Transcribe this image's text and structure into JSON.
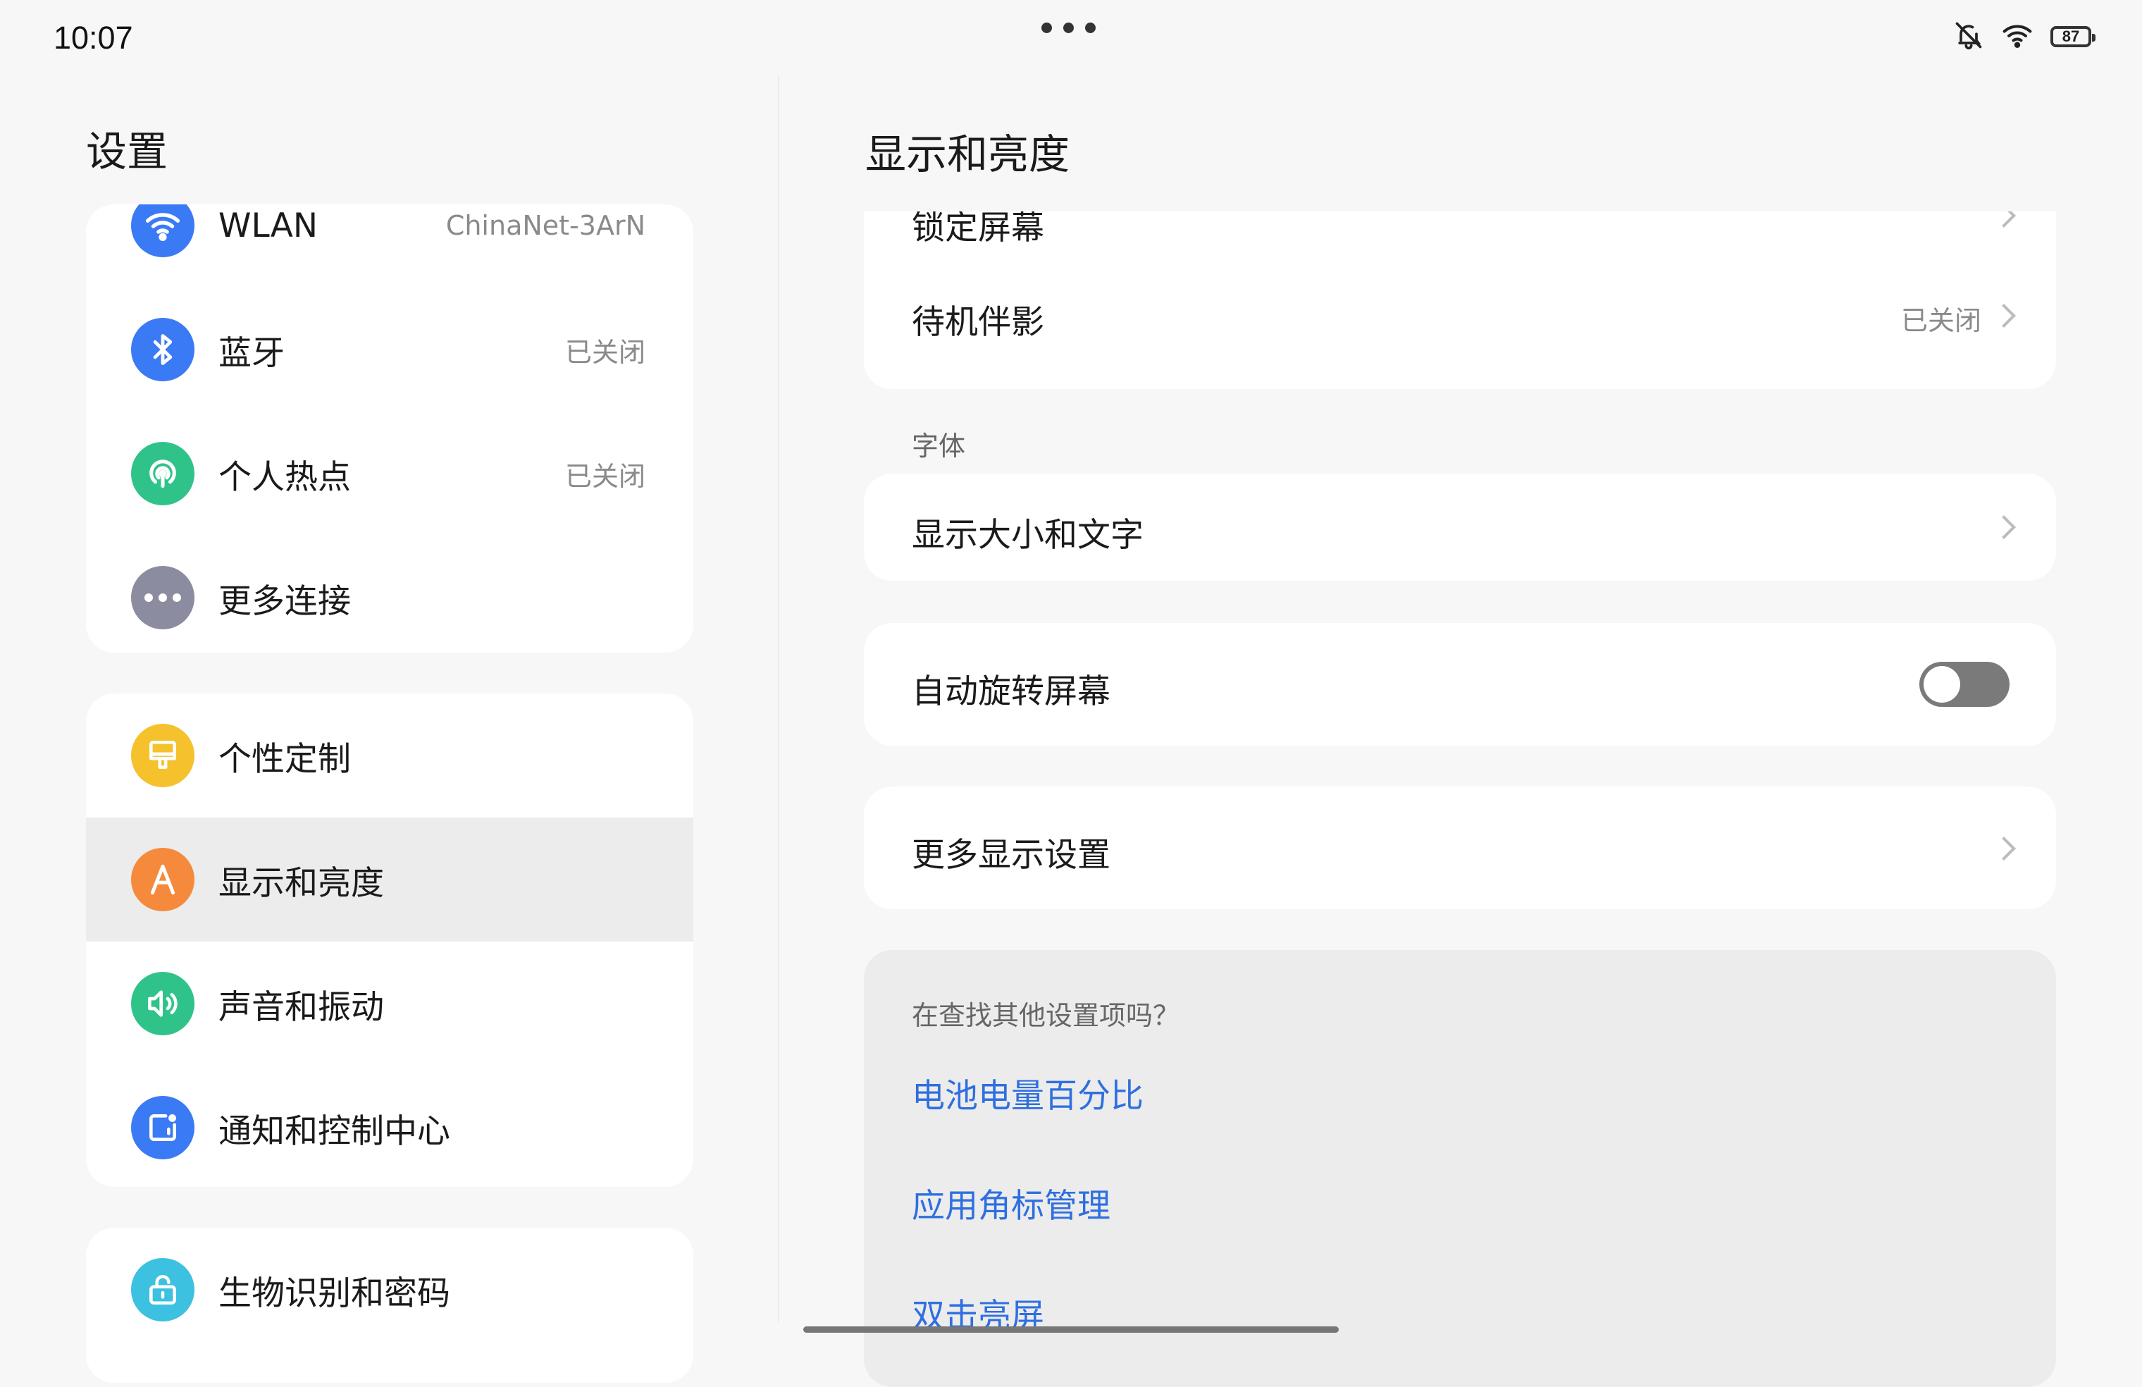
{
  "status_bar": {
    "time": "10:07",
    "battery": "87",
    "icons": [
      "bell-off-icon",
      "wifi-icon",
      "battery-icon"
    ]
  },
  "left": {
    "title": "设置",
    "groups": [
      [
        {
          "label": "WLAN",
          "value": "ChinaNet-3ArN",
          "icon": "wifi-icon",
          "color": "#3b7af5"
        },
        {
          "label": "蓝牙",
          "value": "已关闭",
          "icon": "bluetooth-icon",
          "color": "#3b7af5"
        },
        {
          "label": "个人热点",
          "value": "已关闭",
          "icon": "hotspot-icon",
          "color": "#2fc38a"
        },
        {
          "label": "更多连接",
          "value": "",
          "icon": "more-dots-icon",
          "color": "#8c8ca0"
        }
      ],
      [
        {
          "label": "个性定制",
          "icon": "brush-icon",
          "color": "#f5c12c"
        },
        {
          "label": "显示和亮度",
          "icon": "display-a-icon",
          "color": "#f58a3c",
          "active": true
        },
        {
          "label": "声音和振动",
          "icon": "speaker-icon",
          "color": "#2fc38a"
        },
        {
          "label": "通知和控制中心",
          "icon": "notification-icon",
          "color": "#3b7af5"
        }
      ],
      [
        {
          "label": "生物识别和密码",
          "icon": "lock-icon",
          "color": "#3cc1e0"
        }
      ]
    ]
  },
  "right": {
    "title": "显示和亮度",
    "partial_item": "锁定屏幕",
    "standby": {
      "label": "待机伴影",
      "value": "已关闭"
    },
    "font_section": "字体",
    "display_size": "显示大小和文字",
    "auto_rotate": {
      "label": "自动旋转屏幕",
      "on": false
    },
    "more_display": "更多显示设置",
    "suggestions": {
      "question": "在查找其他设置项吗？",
      "links": [
        "电池电量百分比",
        "应用角标管理",
        "双击亮屏"
      ]
    }
  }
}
